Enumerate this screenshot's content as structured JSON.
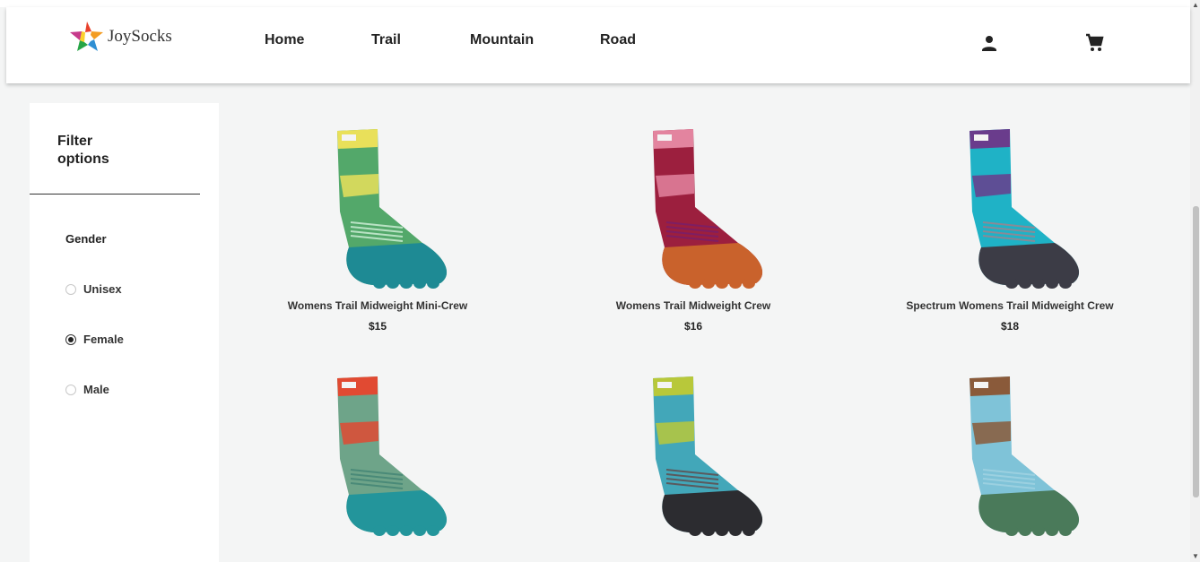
{
  "header": {
    "logo_text": "JoySocks",
    "nav": [
      "Home",
      "Trail",
      "Mountain",
      "Road"
    ],
    "account_icon": "person-icon",
    "cart_icon": "shopping-cart-icon"
  },
  "sidebar": {
    "title": "Filter options",
    "gender_label": "Gender",
    "options": [
      {
        "label": "Unisex",
        "checked": false
      },
      {
        "label": "Female",
        "checked": true
      },
      {
        "label": "Male",
        "checked": false
      }
    ]
  },
  "products": [
    {
      "name": "Womens Trail Midweight Mini-Crew",
      "price": "$15",
      "colors": [
        "#53a86a",
        "#e9e05a",
        "#1e8a94",
        "#b9e2c4"
      ]
    },
    {
      "name": "Womens Trail Midweight Crew",
      "price": "$16",
      "colors": [
        "#9c1f3e",
        "#e3849f",
        "#c9622c",
        "#7e1e63"
      ]
    },
    {
      "name": "Spectrum Womens Trail Midweight Crew",
      "price": "$18",
      "colors": [
        "#1fb2c6",
        "#6a3c8c",
        "#3c3c46",
        "#8a8a96"
      ]
    },
    {
      "name": "",
      "price": "",
      "colors": [
        "#6ea489",
        "#e14a32",
        "#23959b",
        "#4a8a78"
      ]
    },
    {
      "name": "",
      "price": "",
      "colors": [
        "#42a7b9",
        "#b8c83a",
        "#2c2c30",
        "#5a5a5e"
      ]
    },
    {
      "name": "",
      "price": "",
      "colors": [
        "#7fc3d8",
        "#8a5a3a",
        "#4a7a5a",
        "#9bd0e0"
      ]
    }
  ]
}
